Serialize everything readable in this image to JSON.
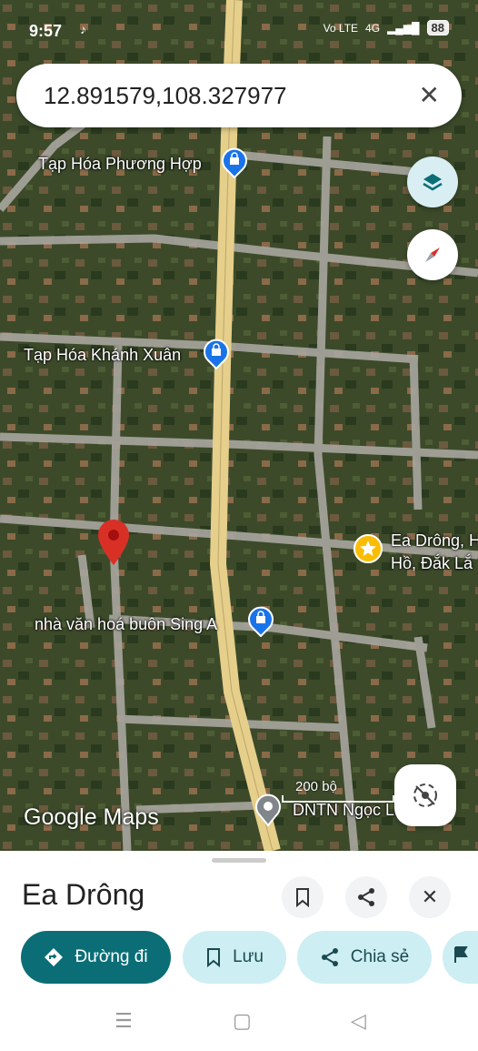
{
  "status": {
    "time": "9:57",
    "network": "Vo LTE",
    "signal": "4G",
    "battery": "88"
  },
  "search": {
    "query": "12.891579,108.327977"
  },
  "map": {
    "labels": {
      "poi1": "Tạp Hóa Phương Hợp",
      "poi2": "Tạp Hóa Khánh Xuân",
      "poi3": "nhà văn hoá buôn Sing A",
      "poi4_line1": "Ea Drông, H",
      "poi4_line2": "Hồ, Đắk Lắ",
      "poi5": "DNTN Ngọc Lo"
    },
    "brand": "Google Maps",
    "scale": "200 bộ",
    "colors": {
      "road_main": "#e6cf8b",
      "road_minor": "#b8b4ae",
      "satellite": "#3b4a2b",
      "pin": "#d93025",
      "poi_blue": "#1a73e8",
      "poi_star": "#fbbc04"
    }
  },
  "sheet": {
    "title": "Ea Drông",
    "actions": {
      "directions": "Đường đi",
      "save": "Lưu",
      "share": "Chia sẻ"
    },
    "colors": {
      "primary": "#0b6e76",
      "chip": "#cdeef3"
    }
  }
}
